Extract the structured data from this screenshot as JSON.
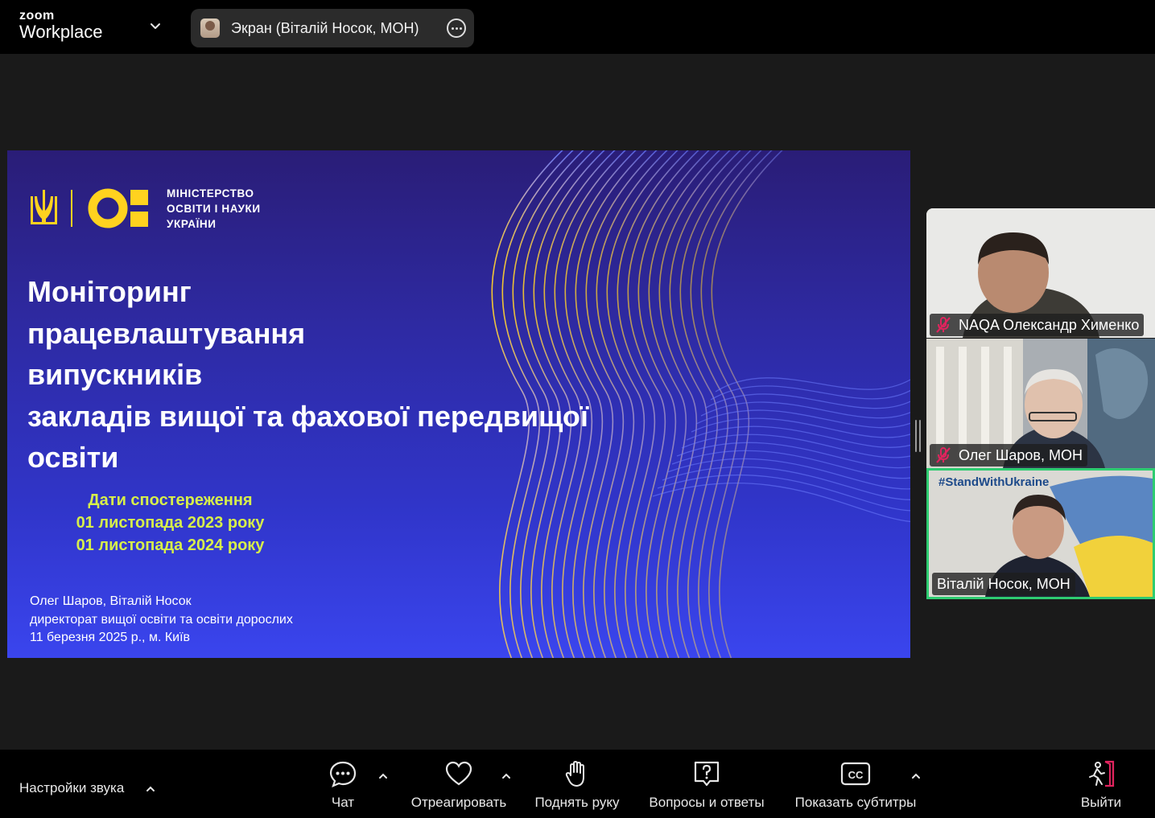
{
  "topbar": {
    "brand_top": "zoom",
    "brand_bottom": "Workplace",
    "share_label": "Экран (Віталій Носок, МОН)"
  },
  "slide": {
    "ministry_lines": [
      "МІНІСТЕРСТВО",
      "ОСВІТИ І НАУКИ",
      "УКРАЇНИ"
    ],
    "title_lines": [
      "Моніторинг",
      "працевлаштування",
      "випускників",
      "закладів вищої та фахової передвищої",
      "освіти"
    ],
    "dates_lines": [
      "Дати спостереження",
      "01 листопада 2023 року",
      "01 листопада 2024 року"
    ],
    "author_lines": [
      "Олег Шаров, Віталій Носок",
      "директорат вищої освіти та освіти дорослих",
      "11 березня 2025 р., м. Київ"
    ],
    "colors": {
      "accent_yellow": "#ffd21f",
      "dates_color": "#d7ef4a",
      "bg_top": "#2a1d77",
      "bg_bottom": "#3a45ee"
    }
  },
  "participants": [
    {
      "name": "NAQA Олександр Хименко",
      "muted": true
    },
    {
      "name": "Олег Шаров, МОН",
      "muted": true
    },
    {
      "name": "Віталій Носок, МОН",
      "muted": false,
      "active_speaker": true,
      "background_text": "#StandWithUkraine"
    }
  ],
  "toolbar": {
    "audio_settings": "Настройки звука",
    "chat": "Чат",
    "react": "Отреагировать",
    "raise_hand": "Поднять руку",
    "qa": "Вопросы и ответы",
    "captions": "Показать субтитры",
    "leave": "Выйти",
    "icons": [
      "chat-icon",
      "heart-icon",
      "hand-icon",
      "question-icon",
      "cc-icon",
      "leave-icon"
    ]
  }
}
